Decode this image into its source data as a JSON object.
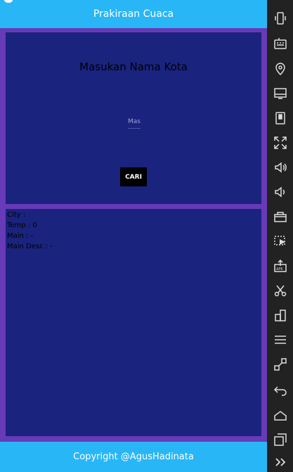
{
  "app": {
    "title": "Prakiraan Cuaca",
    "footer": "Copyright @AgusHadinata",
    "colors": {
      "app_bar": "#29b6f6",
      "background": "#673ab7",
      "panel": "#1a237e",
      "button": "#000000"
    }
  },
  "search": {
    "heading": "Masukan Nama Kota",
    "input_placeholder": "Masukan Nama Kota",
    "input_value": "",
    "button_label": "CARI"
  },
  "result": {
    "city": "City : ",
    "temp": "Temp : 0",
    "main": "Main : -",
    "main_desc": "Main Desc : -"
  },
  "toolbar": {
    "tools": [
      "rotate-device-icon",
      "keyboard-icon",
      "location-icon",
      "screen-icon",
      "sd-card-icon",
      "fullscreen-icon",
      "volume-up-icon",
      "volume-down-icon",
      "camera-icon",
      "screen-record-icon",
      "apk-install-icon",
      "cut-icon",
      "multi-window-icon",
      "menu-icon",
      "resize-icon",
      "back-icon",
      "home-icon",
      "recent-apps-icon",
      "expand-more-icon"
    ]
  }
}
